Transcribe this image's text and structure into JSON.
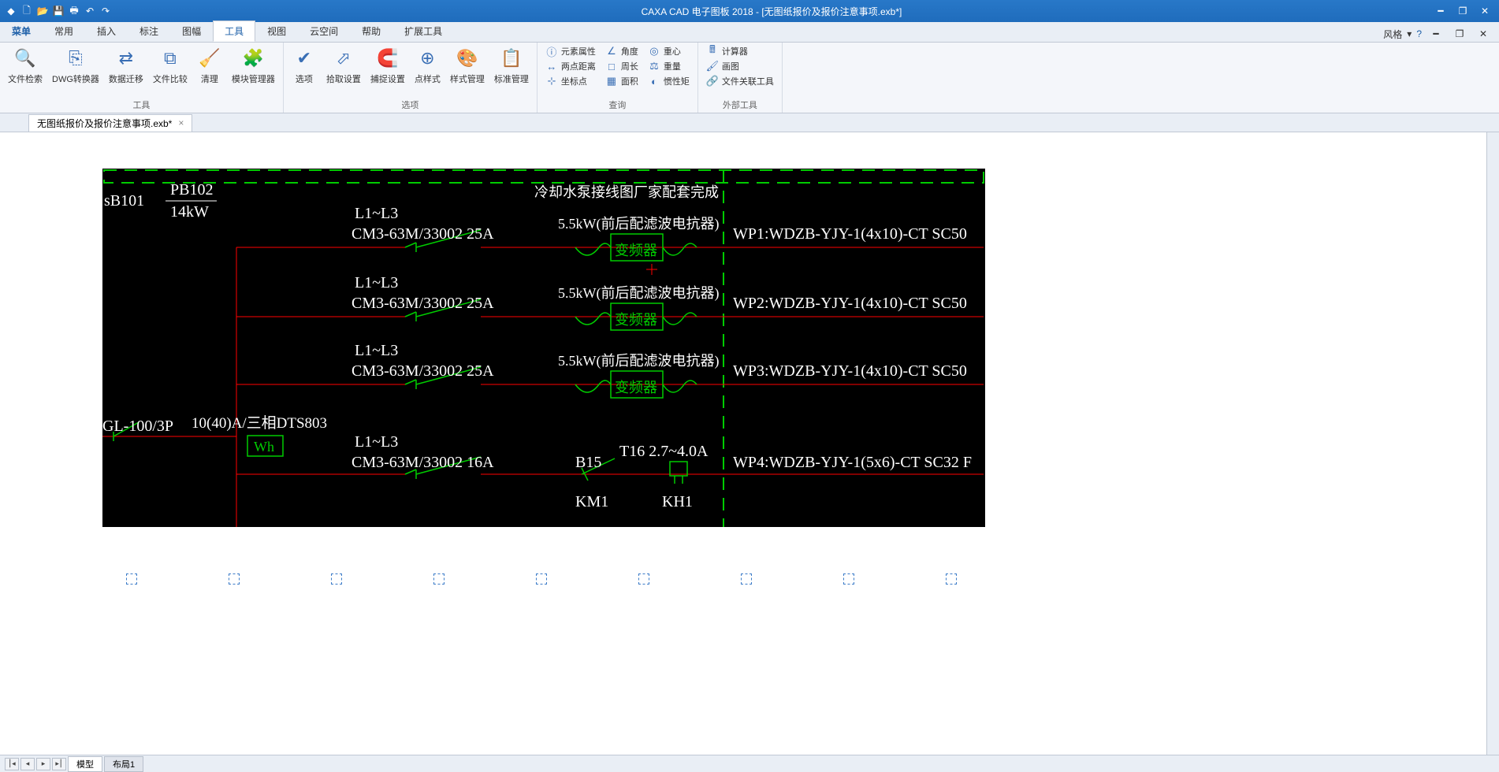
{
  "title": "CAXA CAD 电子图板 2018 - [无图纸报价及报价注意事项.exb*]",
  "menubar_right": {
    "style": "风格"
  },
  "menu": {
    "items": [
      "菜单",
      "常用",
      "插入",
      "标注",
      "图幅",
      "工具",
      "视图",
      "云空间",
      "帮助",
      "扩展工具"
    ],
    "active_index": 5
  },
  "ribbon": {
    "group1": {
      "label": "工具",
      "btns": [
        "文件检索",
        "DWG转换器",
        "数据迁移",
        "文件比较",
        "清理",
        "模块管理器"
      ]
    },
    "group2": {
      "label": "选项",
      "btns": [
        "选项",
        "拾取设置",
        "捕捉设置",
        "点样式",
        "样式管理",
        "标准管理"
      ]
    },
    "group3": {
      "label": "查询",
      "items": [
        [
          "元素属性",
          "角度",
          "重心"
        ],
        [
          "两点距离",
          "周长",
          "重量"
        ],
        [
          "坐标点",
          "面积",
          "惯性矩"
        ]
      ]
    },
    "group4": {
      "label": "外部工具",
      "items": [
        "计算器",
        "画图",
        "文件关联工具"
      ]
    }
  },
  "doc_tab": "无图纸报价及报价注意事项.exb*",
  "view_tabs": {
    "model": "模型",
    "layout1": "布局1"
  },
  "cad": {
    "sb101": "sB101",
    "pb102": "PB102",
    "kw14": "14kW",
    "note_top": "冷却水泵接线图厂家配套完成",
    "lines_top": "L1~L3",
    "breaker_25": "CM3-63M/33002 25A",
    "breaker_16": "CM3-63M/33002 16A",
    "vfd_spec": "5.5kW(前后配滤波电抗器)",
    "vfd_label": "变频器",
    "wp1": "WP1:WDZB-YJY-1(4x10)-CT SC50",
    "wp2": "WP2:WDZB-YJY-1(4x10)-CT SC50",
    "wp3": "WP3:WDZB-YJY-1(4x10)-CT SC50",
    "wp4": "WP4:WDZB-YJY-1(5x6)-CT SC32 F",
    "gl": "GL-100/3P",
    "meter_spec": "10(40)A/三相DTS803",
    "wh": "Wh",
    "b15": "B15",
    "km1": "KM1",
    "t16": "T16 2.7~4.0A",
    "kh1": "KH1"
  }
}
